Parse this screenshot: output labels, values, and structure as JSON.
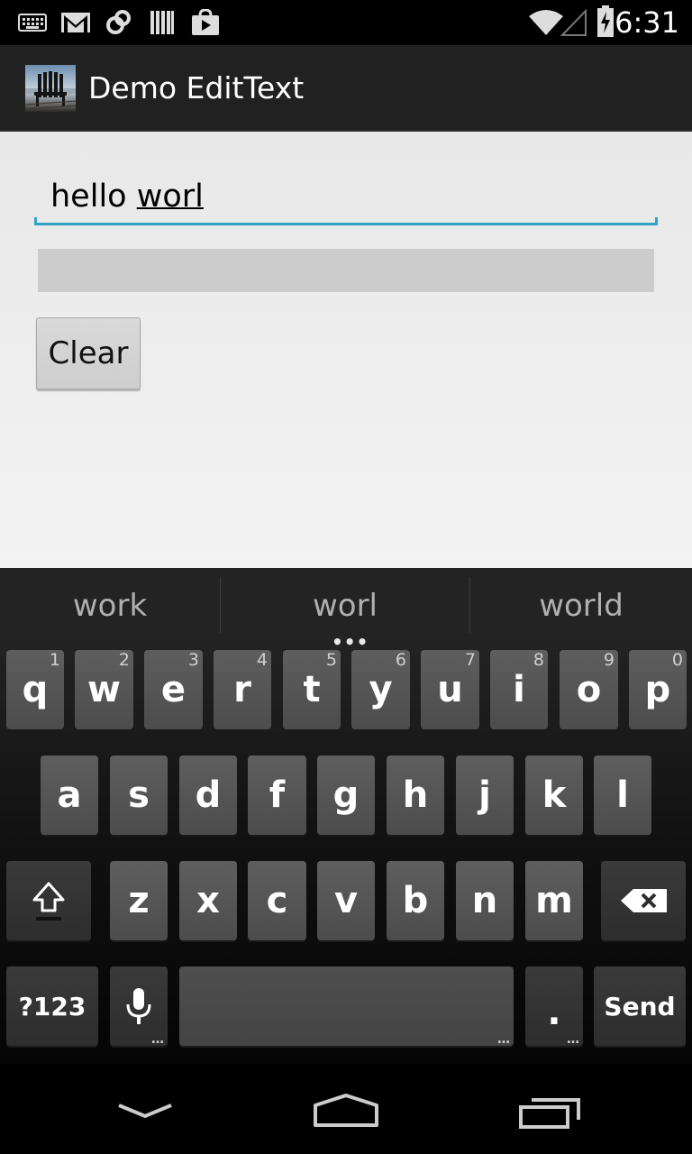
{
  "status_bar": {
    "time": "6:31",
    "icons": [
      "keyboard-icon",
      "gmail-icon",
      "sync-icon",
      "library-icon",
      "play-store-icon",
      "wifi-icon",
      "signal-icon",
      "battery-charging-icon"
    ]
  },
  "action_bar": {
    "title": "Demo EditText",
    "app_icon": "chair-dock-photo"
  },
  "main": {
    "edit_text_prefix": "hello ",
    "edit_text_composing": "worl",
    "display_text": "",
    "clear_button": "Clear"
  },
  "keyboard": {
    "suggestions": [
      "work",
      "worl",
      "world"
    ],
    "row1": [
      {
        "label": "q",
        "alt": "1"
      },
      {
        "label": "w",
        "alt": "2"
      },
      {
        "label": "e",
        "alt": "3"
      },
      {
        "label": "r",
        "alt": "4"
      },
      {
        "label": "t",
        "alt": "5"
      },
      {
        "label": "y",
        "alt": "6"
      },
      {
        "label": "u",
        "alt": "7"
      },
      {
        "label": "i",
        "alt": "8"
      },
      {
        "label": "o",
        "alt": "9"
      },
      {
        "label": "p",
        "alt": "0"
      }
    ],
    "row2": [
      "a",
      "s",
      "d",
      "f",
      "g",
      "h",
      "j",
      "k",
      "l"
    ],
    "row3": [
      "z",
      "x",
      "c",
      "v",
      "b",
      "n",
      "m"
    ],
    "symbols_label": "?123",
    "period_label": ".",
    "send_label": "Send"
  },
  "nav_bar": {
    "icons": [
      "back-icon",
      "home-icon",
      "recents-icon"
    ]
  }
}
